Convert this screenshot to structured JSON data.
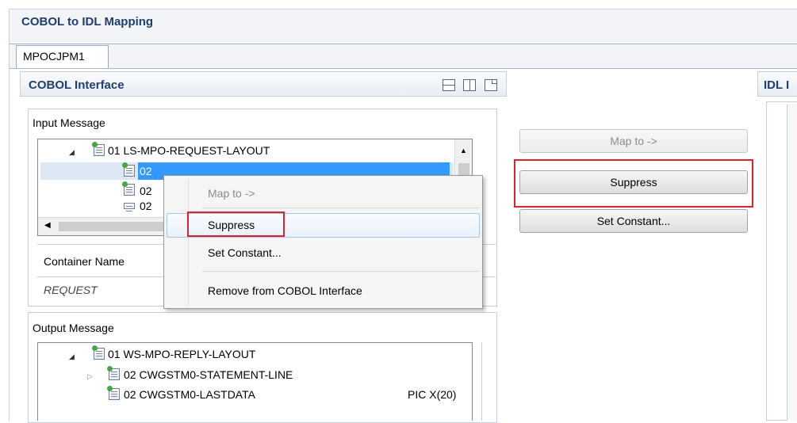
{
  "window": {
    "title": "COBOL to IDL Mapping"
  },
  "tabs": [
    {
      "label": "MPOCJPM1"
    }
  ],
  "left_panel": {
    "title": "COBOL Interface",
    "input_section": {
      "label": "Input Message",
      "tree": {
        "root": "01 LS-MPO-REQUEST-LAYOUT",
        "children": [
          "02",
          "02",
          "02"
        ]
      }
    },
    "container_table": {
      "header": "Container Name",
      "row": "REQUEST"
    },
    "output_section": {
      "label": "Output Message",
      "tree": {
        "root": "01 WS-MPO-REPLY-LAYOUT",
        "children": [
          {
            "label": "02 CWGSTM0-STATEMENT-LINE",
            "pic": ""
          },
          {
            "label": "02 CWGSTM0-LASTDATA",
            "pic": "PIC X(20)"
          }
        ]
      }
    }
  },
  "middle_buttons": {
    "map_to": "Map to ->",
    "suppress": "Suppress",
    "set_constant": "Set Constant..."
  },
  "right_panel": {
    "title": "IDL I"
  },
  "context_menu": {
    "items": {
      "map_to": "Map to ->",
      "suppress": "Suppress",
      "set_constant": "Set Constant...",
      "remove": "Remove from COBOL Interface"
    }
  },
  "colors": {
    "highlight": "#d9242f",
    "selection": "#3399ff",
    "title": "#1f3e6b"
  },
  "icons": [
    "copybook-field-icon",
    "expand-arrow-icon",
    "collapse-arrow-icon",
    "minimize-icon",
    "maximize-icon",
    "restore-icon"
  ]
}
